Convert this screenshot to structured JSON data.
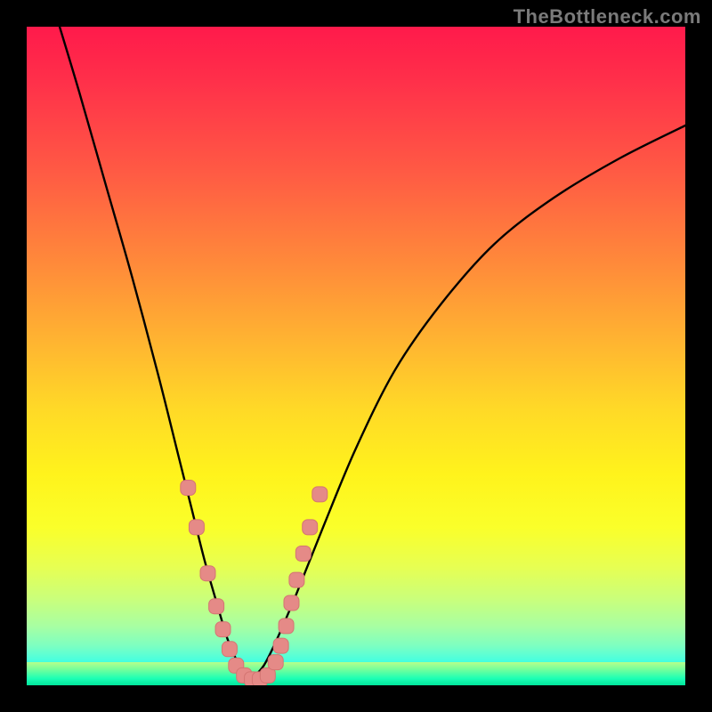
{
  "watermark": {
    "text": "TheBottleneck.com"
  },
  "colors": {
    "curve_stroke": "#000000",
    "marker_fill": "#e58a87",
    "marker_stroke": "#d47572"
  },
  "chart_data": {
    "type": "line",
    "title": "",
    "xlabel": "",
    "ylabel": "",
    "xlim": [
      0,
      100
    ],
    "ylim": [
      0,
      100
    ],
    "axes_visible": false,
    "grid": false,
    "series": [
      {
        "name": "left-branch",
        "x": [
          5,
          8,
          12,
          16,
          20,
          23,
          25,
          27,
          29,
          30.5,
          32,
          33,
          34
        ],
        "values": [
          100,
          90,
          76,
          62,
          47,
          35,
          27,
          19,
          12,
          7,
          3.5,
          1.5,
          0.8
        ]
      },
      {
        "name": "right-branch",
        "x": [
          34,
          36,
          38,
          41,
          45,
          50,
          56,
          63,
          71,
          80,
          90,
          100
        ],
        "values": [
          0.8,
          3,
          7,
          14,
          24,
          36,
          48,
          58,
          67,
          74,
          80,
          85
        ]
      }
    ],
    "markers": [
      {
        "series": "left-branch",
        "x": 24.5,
        "y": 30
      },
      {
        "series": "left-branch",
        "x": 25.8,
        "y": 24
      },
      {
        "series": "left-branch",
        "x": 27.5,
        "y": 17
      },
      {
        "series": "left-branch",
        "x": 28.8,
        "y": 12
      },
      {
        "series": "left-branch",
        "x": 29.8,
        "y": 8.5
      },
      {
        "series": "left-branch",
        "x": 30.8,
        "y": 5.5
      },
      {
        "series": "left-branch",
        "x": 31.8,
        "y": 3
      },
      {
        "series": "left-branch",
        "x": 33.0,
        "y": 1.5
      },
      {
        "series": "left-branch",
        "x": 34.2,
        "y": 0.9
      },
      {
        "series": "left-branch",
        "x": 35.4,
        "y": 0.9
      },
      {
        "series": "right-branch",
        "x": 36.6,
        "y": 1.5
      },
      {
        "series": "right-branch",
        "x": 37.8,
        "y": 3.5
      },
      {
        "series": "right-branch",
        "x": 38.6,
        "y": 6
      },
      {
        "series": "right-branch",
        "x": 39.4,
        "y": 9
      },
      {
        "series": "right-branch",
        "x": 40.2,
        "y": 12.5
      },
      {
        "series": "right-branch",
        "x": 41.0,
        "y": 16
      },
      {
        "series": "right-branch",
        "x": 42.0,
        "y": 20
      },
      {
        "series": "right-branch",
        "x": 43.0,
        "y": 24
      },
      {
        "series": "right-branch",
        "x": 44.5,
        "y": 29
      }
    ]
  }
}
